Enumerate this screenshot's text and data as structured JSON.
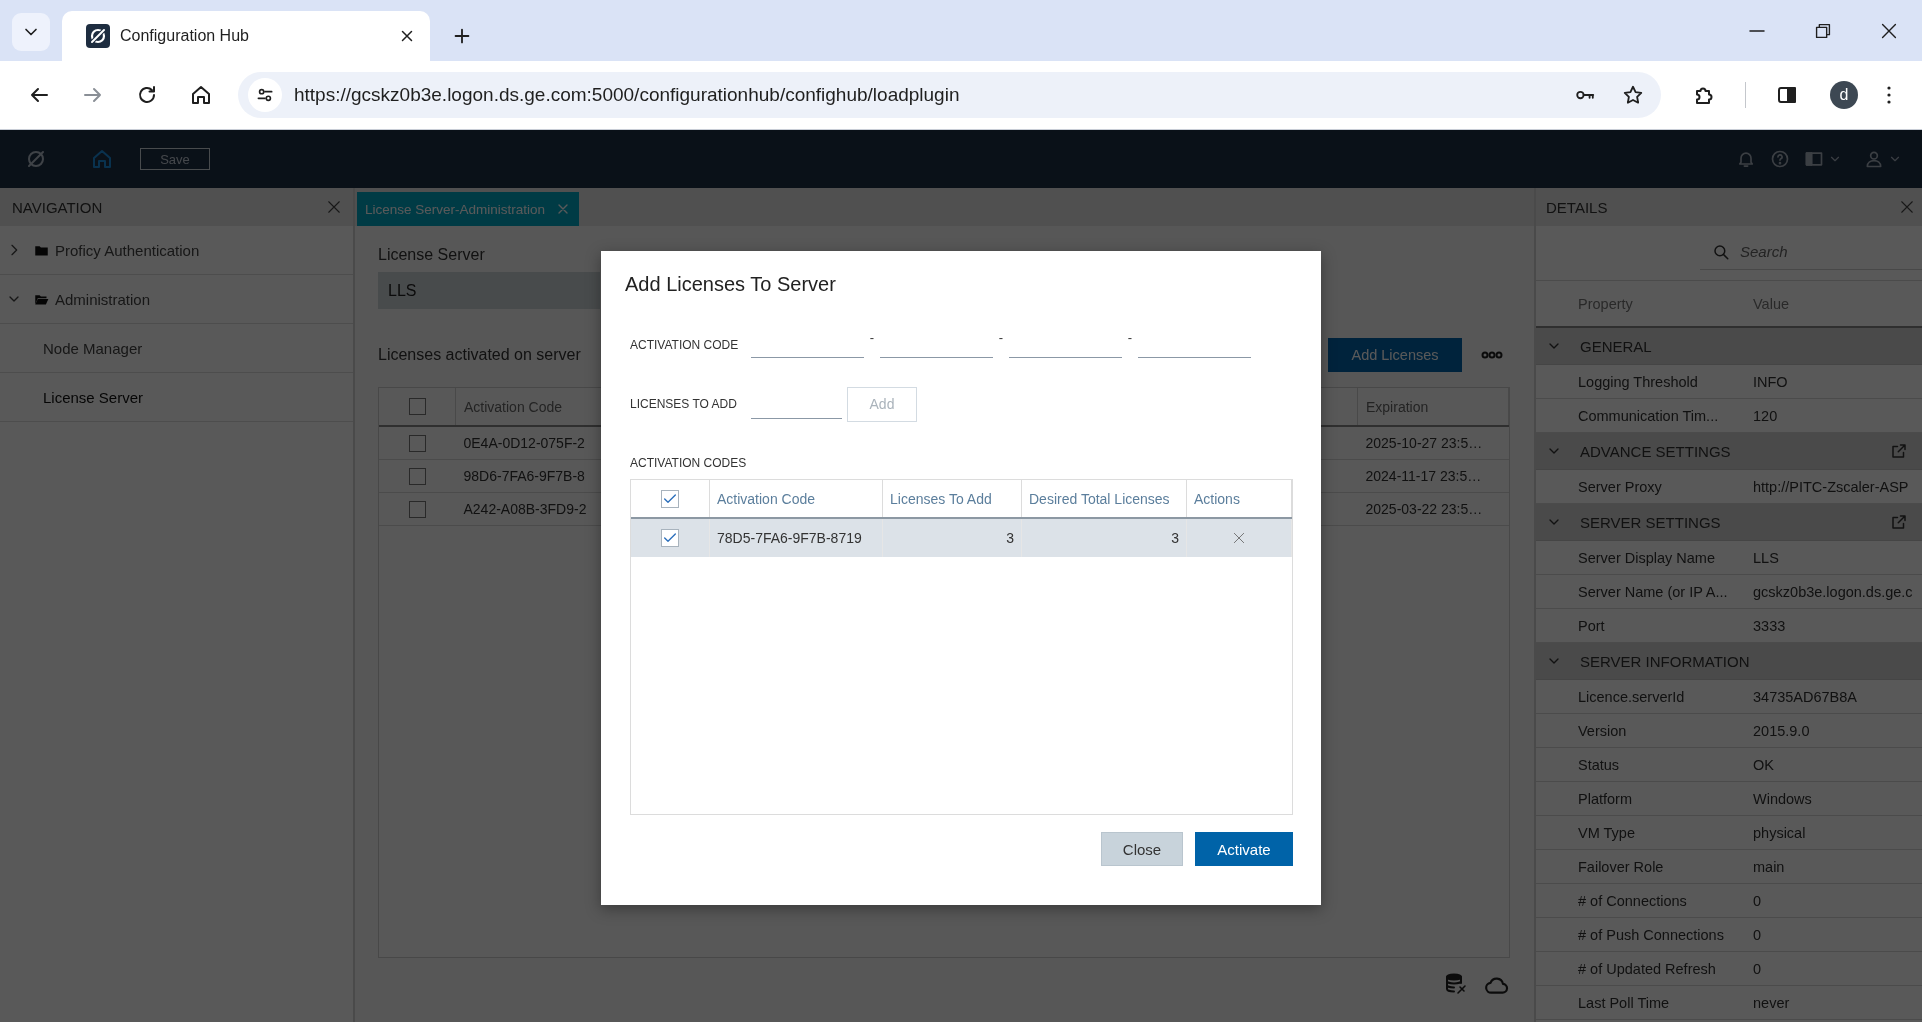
{
  "browser": {
    "tab_title": "Configuration Hub",
    "url": "https://gcskz0b3e.logon.ds.ge.com:5000/configurationhub/confighub/loadplugin",
    "profile_initial": "d"
  },
  "app_header": {
    "save_label": "Save",
    "save_disabled": true
  },
  "navigation": {
    "title": "NAVIGATION",
    "items": [
      {
        "label": "Proficy Authentication",
        "expanded": false
      },
      {
        "label": "Administration",
        "expanded": true,
        "children": [
          {
            "label": "Node Manager",
            "selected": false
          },
          {
            "label": "License Server",
            "selected": true
          }
        ]
      }
    ]
  },
  "tabs": [
    {
      "label": "License Server-Administration",
      "selected": true
    }
  ],
  "license_server": {
    "label": "License Server",
    "value": "LLS"
  },
  "licenses": {
    "title": "Licenses activated on server",
    "add_button": "Add Licenses",
    "all_checked": false,
    "columns": [
      "Activation Code",
      "Expiration"
    ],
    "rows": [
      {
        "code": "0E4A-0D12-075F-2",
        "expiration": "2025-10-27 23:5…",
        "checked": false
      },
      {
        "code": "98D6-7FA6-9F7B-8",
        "expiration": "2024-11-17 23:5…",
        "checked": false
      },
      {
        "code": "A242-A08B-3FD9-2",
        "expiration": "2025-03-22 23:5…",
        "checked": false
      }
    ]
  },
  "dialog": {
    "title": "Add Licenses To Server",
    "activation_code_label": "ACTIVATION CODE",
    "code_separators": [
      "-",
      "-",
      "-"
    ],
    "licenses_to_add_label": "LICENSES TO ADD",
    "add_button": {
      "label": "Add",
      "disabled": true
    },
    "codes_label": "ACTIVATION CODES",
    "table": {
      "all_checked": true,
      "columns": [
        "Activation Code",
        "Licenses To Add",
        "Desired Total Licenses",
        "Actions"
      ],
      "rows": [
        {
          "code": "78D5-7FA6-9F7B-8719",
          "licenses_to_add": "3",
          "desired_total": "3",
          "checked": true,
          "selected": true
        }
      ]
    },
    "buttons": [
      {
        "label": "Close",
        "kind": "secondary"
      },
      {
        "label": "Activate",
        "kind": "primary"
      }
    ]
  },
  "details": {
    "title": "DETAILS",
    "search_placeholder": "Search",
    "columns": [
      "Property",
      "Value"
    ],
    "groups": [
      {
        "title": "GENERAL",
        "expanded": true,
        "popout": false,
        "rows": [
          {
            "property": "Logging Threshold",
            "value": "INFO"
          },
          {
            "property": "Communication Tim...",
            "value": "120"
          }
        ]
      },
      {
        "title": "ADVANCE SETTINGS",
        "expanded": true,
        "popout": true,
        "rows": [
          {
            "property": "Server Proxy",
            "value": "http://PITC-Zscaler-ASP"
          }
        ]
      },
      {
        "title": "SERVER SETTINGS",
        "expanded": true,
        "popout": true,
        "rows": [
          {
            "property": "Server Display Name",
            "value": "LLS"
          },
          {
            "property": "Server Name (or IP A...",
            "value": "gcskz0b3e.logon.ds.ge.c"
          },
          {
            "property": "Port",
            "value": "3333"
          }
        ]
      },
      {
        "title": "SERVER INFORMATION",
        "expanded": true,
        "popout": false,
        "rows": [
          {
            "property": "Licence.serverId",
            "value": "34735AD67B8A"
          },
          {
            "property": "Version",
            "value": "2015.9.0"
          },
          {
            "property": "Status",
            "value": "OK"
          },
          {
            "property": "Platform",
            "value": "Windows"
          },
          {
            "property": "VM Type",
            "value": "physical"
          },
          {
            "property": "Failover Role",
            "value": "main"
          },
          {
            "property": "# of Connections",
            "value": "0"
          },
          {
            "property": "# of Push Connections",
            "value": "0"
          },
          {
            "property": "# of Updated Refresh",
            "value": "0"
          },
          {
            "property": "Last Poll Time",
            "value": "never"
          }
        ]
      }
    ]
  }
}
